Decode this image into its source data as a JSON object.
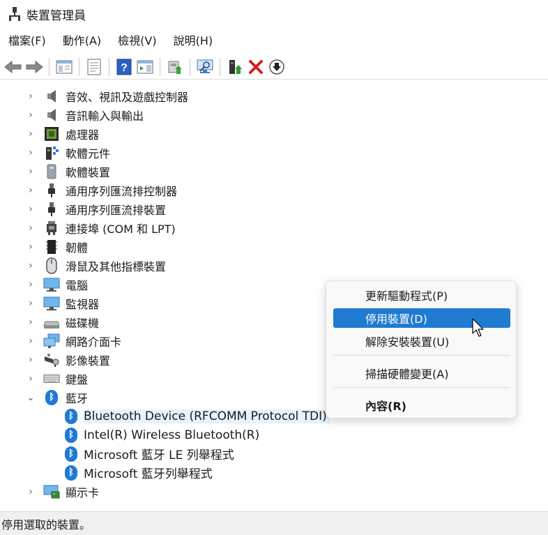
{
  "window": {
    "title": "裝置管理員"
  },
  "menubar": [
    {
      "label": "檔案(F)"
    },
    {
      "label": "動作(A)"
    },
    {
      "label": "檢視(V)"
    },
    {
      "label": "說明(H)"
    }
  ],
  "toolbar": {
    "buttons": [
      "back-icon",
      "forward-icon",
      "show-hide-console-icon",
      "properties-icon",
      "help-icon",
      "action-pane-icon",
      "update-driver-icon",
      "scan-hardware-icon",
      "enable-device-icon",
      "uninstall-icon",
      "disable-device-icon"
    ]
  },
  "tree": {
    "categories": [
      {
        "label": "音效、視訊及遊戲控制器",
        "icon": "speaker-icon"
      },
      {
        "label": "音訊輸入與輸出",
        "icon": "speaker-icon"
      },
      {
        "label": "處理器",
        "icon": "processor-icon"
      },
      {
        "label": "軟體元件",
        "icon": "software-component-icon"
      },
      {
        "label": "軟體裝置",
        "icon": "software-device-icon"
      },
      {
        "label": "通用序列匯流排控制器",
        "icon": "usb-icon"
      },
      {
        "label": "通用序列匯流排裝置",
        "icon": "usb-icon"
      },
      {
        "label": "連接埠 (COM 和 LPT)",
        "icon": "port-icon"
      },
      {
        "label": "韌體",
        "icon": "firmware-icon"
      },
      {
        "label": "滑鼠及其他指標裝置",
        "icon": "mouse-icon"
      },
      {
        "label": "電腦",
        "icon": "computer-icon"
      },
      {
        "label": "監視器",
        "icon": "monitor-icon"
      },
      {
        "label": "磁碟機",
        "icon": "disk-drive-icon"
      },
      {
        "label": "網路介面卡",
        "icon": "network-adapter-icon"
      },
      {
        "label": "影像裝置",
        "icon": "camera-icon"
      },
      {
        "label": "鍵盤",
        "icon": "keyboard-icon"
      },
      {
        "label": "藍牙",
        "icon": "bluetooth-icon"
      }
    ],
    "bluetooth_children": [
      {
        "label": "Bluetooth Device (RFCOMM Protocol TDI)"
      },
      {
        "label": "Intel(R) Wireless Bluetooth(R)"
      },
      {
        "label": "Microsoft 藍牙 LE 列舉程式"
      },
      {
        "label": "Microsoft 藍牙列舉程式"
      }
    ],
    "after": {
      "label": "顯示卡",
      "icon": "display-adapter-icon"
    }
  },
  "context_menu": {
    "update_driver": "更新驅動程式(P)",
    "disable_device": "停用裝置(D)",
    "uninstall_device": "解除安裝裝置(U)",
    "scan_hardware": "掃描硬體變更(A)",
    "properties": "內容(R)"
  },
  "statusbar": {
    "text": "停用選取的裝置。"
  },
  "colors": {
    "accent": "#1f7bd1",
    "selection": "#e5f3ff",
    "bluetooth": "#1f7ad6",
    "delete": "#d32020"
  }
}
